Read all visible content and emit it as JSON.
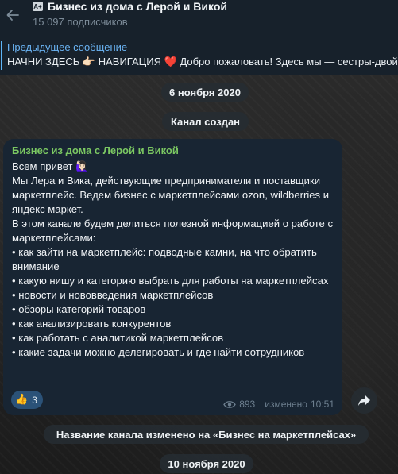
{
  "header": {
    "channel_badge": "A+",
    "title": "Бизнес из дома с Лерой и Викой",
    "subscribers": "15 097 подписчиков"
  },
  "pinned": {
    "title": "Предыдущее сообщение",
    "text_a": "НАЧНИ ЗДЕСЬ 👉🏻 НАВИГАЦИЯ ",
    "heart": "❤️",
    "text_b": "  Добро пожаловать! Здесь мы — сестры-двой"
  },
  "service": {
    "date1": "6 ноября 2020",
    "created": "Канал создан",
    "renamed": "Название канала изменено на «Бизнес на маркетплейсах»",
    "date2": "10 ноября 2020"
  },
  "message": {
    "author": "Бизнес из дома с Лерой и Викой",
    "lines": [
      "Всем привет 🙋🏻‍♀️",
      "Мы Лера и Вика, действующие предприниматели и поставщики маркетплейс. Ведем бизнес с маркетплейсами ozon, wildberries и яндекс маркет.",
      "",
      "В этом канале будем делиться полезной информацией о работе с маркетплейсами:",
      "• как зайти на маркетплейс: подводные камни, на что обратить внимание",
      "• какую нишу и категорию выбрать для работы на маркетплейсах",
      "• новости и нововведения маркетплейсов",
      "• обзоры категорий товаров",
      "• как анализировать конкурентов",
      "• как работать с аналитикой маркетплейсов",
      "• какие задачи можно делегировать и где найти сотрудников"
    ],
    "reaction_emoji": "👍",
    "reaction_count": "3",
    "views": "893",
    "edited": "изменено",
    "time": "10:51"
  },
  "colors": {
    "header_bg": "#17212b",
    "accent": "#6ab3f3",
    "author": "#7bc862",
    "bubble": "#182533",
    "reaction": "#2b5278"
  },
  "icons": [
    "back-arrow-icon",
    "eye-icon",
    "share-arrow-icon"
  ]
}
